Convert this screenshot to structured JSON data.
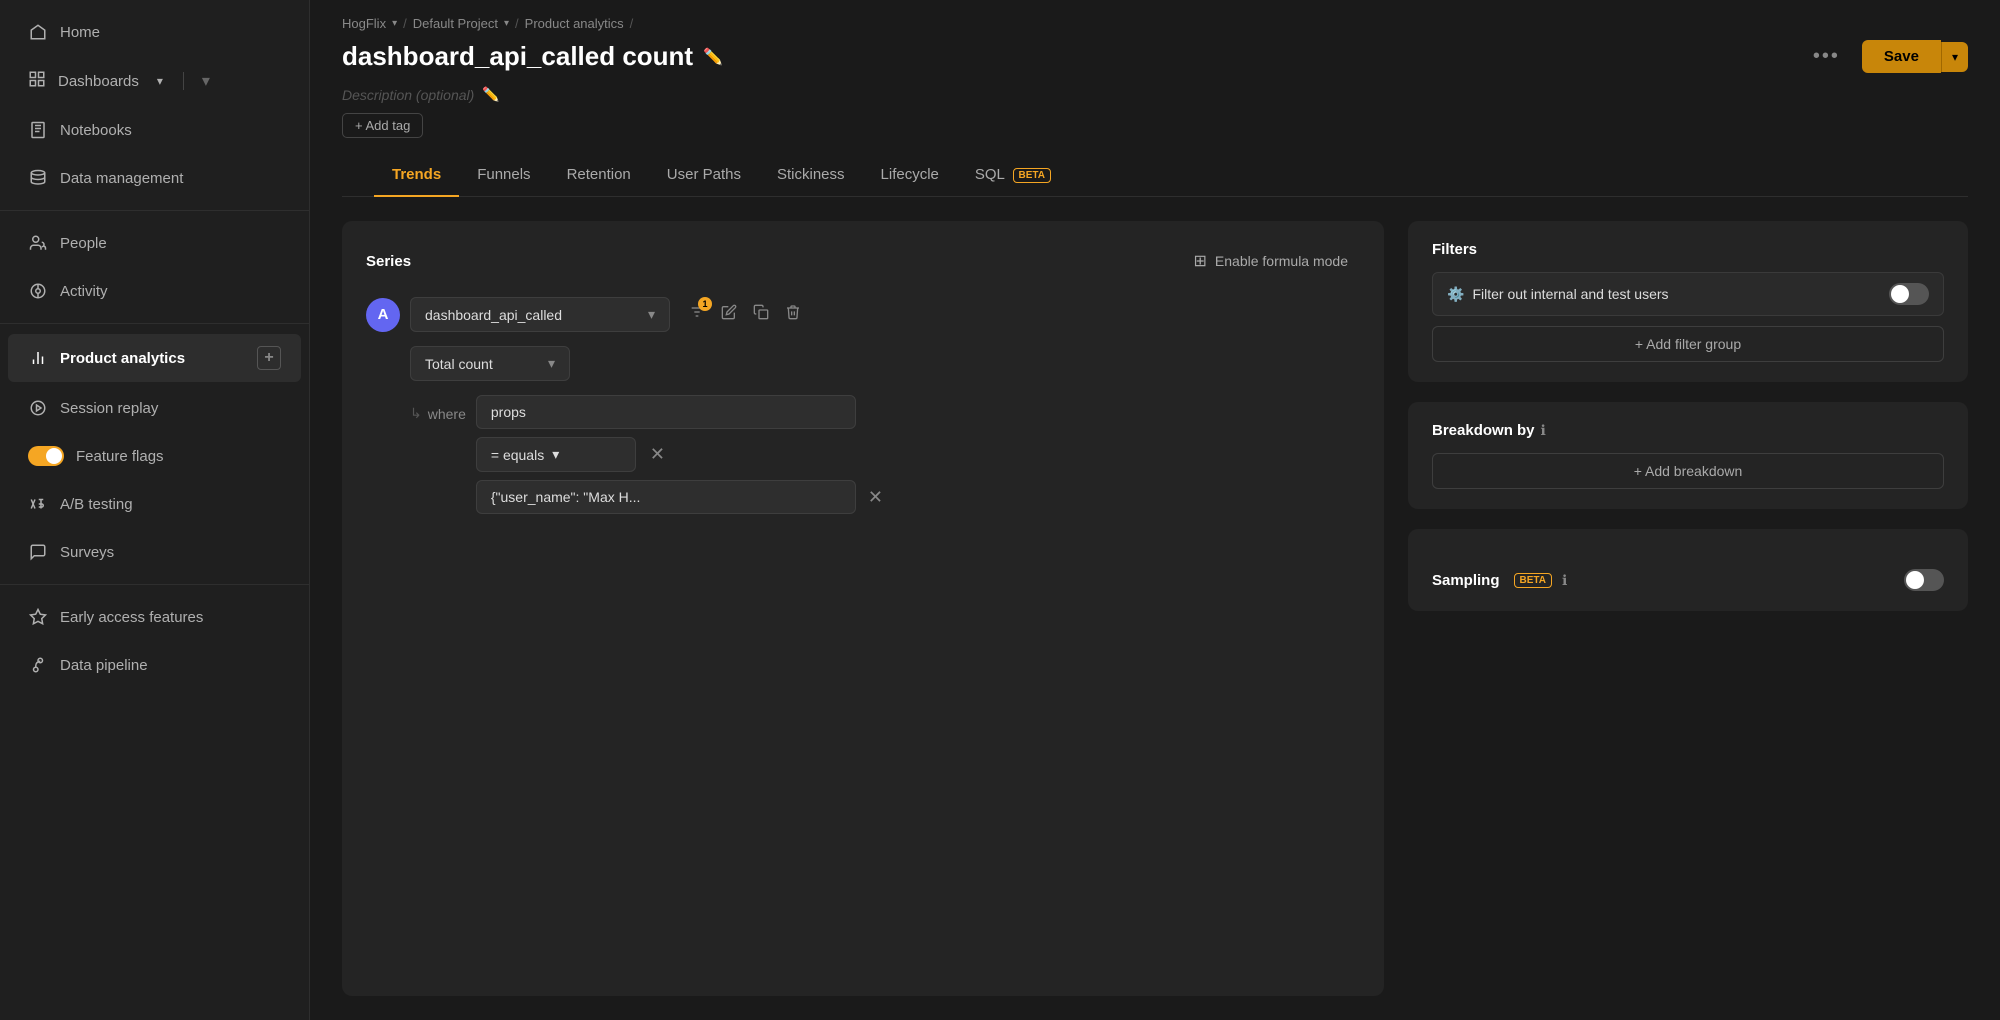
{
  "sidebar": {
    "items": [
      {
        "id": "home",
        "label": "Home",
        "icon": "home"
      },
      {
        "id": "dashboards",
        "label": "Dashboards",
        "icon": "dashboards",
        "hasChevron": true
      },
      {
        "id": "notebooks",
        "label": "Notebooks",
        "icon": "notebooks"
      },
      {
        "id": "data-management",
        "label": "Data management",
        "icon": "data-management"
      },
      {
        "id": "people",
        "label": "People",
        "icon": "people"
      },
      {
        "id": "activity",
        "label": "Activity",
        "icon": "activity"
      },
      {
        "id": "product-analytics",
        "label": "Product analytics",
        "icon": "product-analytics",
        "active": true,
        "hasPlus": true
      },
      {
        "id": "session-replay",
        "label": "Session replay",
        "icon": "session-replay"
      },
      {
        "id": "feature-flags",
        "label": "Feature flags",
        "icon": "feature-flags",
        "isToggle": true
      },
      {
        "id": "ab-testing",
        "label": "A/B testing",
        "icon": "ab-testing"
      },
      {
        "id": "surveys",
        "label": "Surveys",
        "icon": "surveys"
      },
      {
        "id": "early-access",
        "label": "Early access features",
        "icon": "early-access"
      },
      {
        "id": "data-pipeline",
        "label": "Data pipeline",
        "icon": "data-pipeline"
      }
    ]
  },
  "breadcrumb": {
    "parts": [
      {
        "label": "HogFlix",
        "hasDropdown": true
      },
      {
        "label": "Default Project",
        "hasDropdown": true
      },
      {
        "label": "Product analytics",
        "hasDropdown": false
      }
    ]
  },
  "header": {
    "title": "dashboard_api_called count",
    "description_placeholder": "Description (optional)",
    "add_tag_label": "+ Add tag",
    "more_label": "•••",
    "save_label": "Save"
  },
  "tabs": [
    {
      "id": "trends",
      "label": "Trends",
      "active": true
    },
    {
      "id": "funnels",
      "label": "Funnels",
      "active": false
    },
    {
      "id": "retention",
      "label": "Retention",
      "active": false
    },
    {
      "id": "user-paths",
      "label": "User Paths",
      "active": false
    },
    {
      "id": "stickiness",
      "label": "Stickiness",
      "active": false
    },
    {
      "id": "lifecycle",
      "label": "Lifecycle",
      "active": false
    },
    {
      "id": "sql",
      "label": "SQL",
      "active": false,
      "badge": "BETA"
    }
  ],
  "series": {
    "title": "Series",
    "formula_mode_label": "Enable formula mode",
    "letter": "A",
    "event_name": "dashboard_api_called",
    "count_label": "Total count",
    "where_label": "where",
    "filter_prop": "props",
    "filter_op": "= equals",
    "filter_value": "{\"user_name\": \"Max H..."
  },
  "filters": {
    "title": "Filters",
    "internal_filter_label": "Filter out internal and test users",
    "add_filter_group_label": "+ Add filter group"
  },
  "breakdown": {
    "title": "Breakdown by",
    "add_breakdown_label": "+ Add breakdown"
  },
  "sampling": {
    "label": "Sampling",
    "badge": "BETA"
  }
}
